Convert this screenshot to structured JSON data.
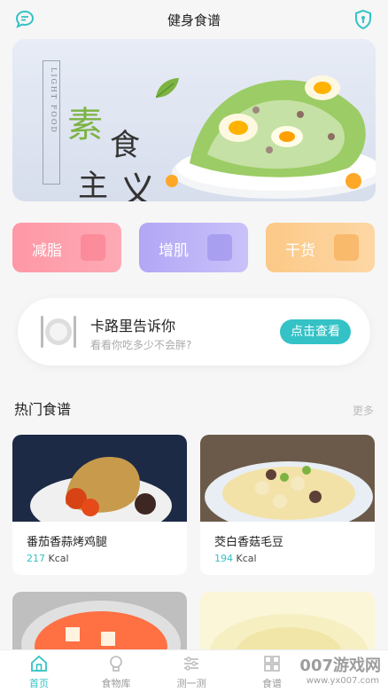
{
  "header": {
    "title": "健身食谱",
    "left_icon": "chat-bubble-icon",
    "right_icon": "shield-icon"
  },
  "banner": {
    "vertical_text": "LIGHT FOOD",
    "chars": [
      "素",
      "食",
      "主",
      "义"
    ]
  },
  "categories": [
    {
      "label": "减脂",
      "icon": "scale-icon"
    },
    {
      "label": "增肌",
      "icon": "dumbbell-icon"
    },
    {
      "label": "干货",
      "icon": "document-icon"
    }
  ],
  "calorie_card": {
    "title": "卡路里告诉你",
    "subtitle": "看看你吃多少不会胖?",
    "button": "点击查看"
  },
  "recipes": {
    "title": "热门食谱",
    "more": "更多",
    "unit": "Kcal",
    "items": [
      {
        "name": "番茄香蒜烤鸡腿",
        "kcal": "217"
      },
      {
        "name": "茭白香菇毛豆",
        "kcal": "194"
      }
    ]
  },
  "tabbar": [
    {
      "label": "首页",
      "icon": "home-icon",
      "active": true
    },
    {
      "label": "食物库",
      "icon": "lightbulb-icon",
      "active": false
    },
    {
      "label": "测一测",
      "icon": "sliders-icon",
      "active": false
    },
    {
      "label": "食谱",
      "icon": "grid-icon",
      "active": false
    }
  ],
  "watermark": {
    "main": "007游戏网",
    "url": "www.yx007.com"
  },
  "colors": {
    "accent": "#34c2c6",
    "cat1": "#fe98a6",
    "cat2": "#b1a7f5",
    "cat3": "#fcc987"
  }
}
